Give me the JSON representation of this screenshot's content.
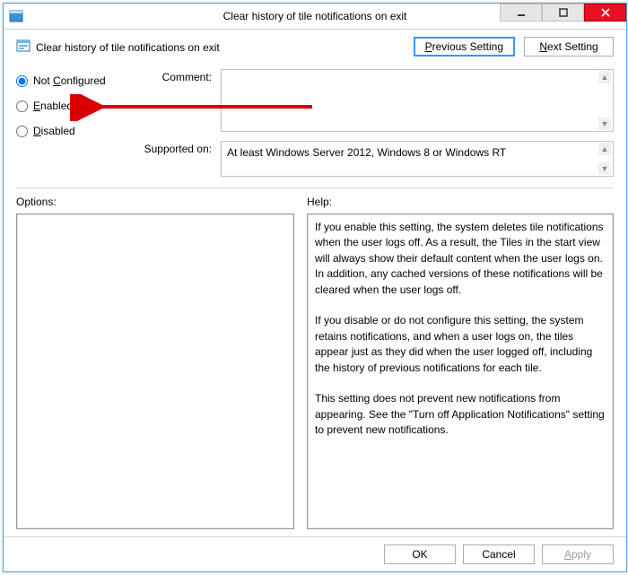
{
  "window": {
    "title": "Clear history of tile notifications on exit"
  },
  "header": {
    "policy_title": "Clear history of tile notifications on exit",
    "prev_label": "Previous Setting",
    "next_label": "Next Setting"
  },
  "state": {
    "not_configured_label": "Not Configured",
    "enabled_label": "Enabled",
    "disabled_label": "Disabled",
    "selected": "not_configured"
  },
  "fields": {
    "comment_label": "Comment:",
    "comment_text": "",
    "supported_label": "Supported on:",
    "supported_text": "At least Windows Server 2012, Windows 8 or Windows RT"
  },
  "options": {
    "label": "Options:",
    "text": ""
  },
  "help": {
    "label": "Help:",
    "text": "If you enable this setting, the system deletes tile notifications when the user logs off. As a result, the Tiles in the start view will always show their default content when the user logs on. In addition, any cached versions of these notifications will be cleared when the user logs off.\n\nIf you disable or do not configure this setting, the system retains notifications, and when a user logs on, the tiles appear just as they did when the user logged off, including the history of previous notifications for each tile.\n\nThis setting does not prevent new notifications from appearing. See the \"Turn off Application Notifications\" setting to prevent new notifications."
  },
  "footer": {
    "ok": "OK",
    "cancel": "Cancel",
    "apply": "Apply"
  }
}
